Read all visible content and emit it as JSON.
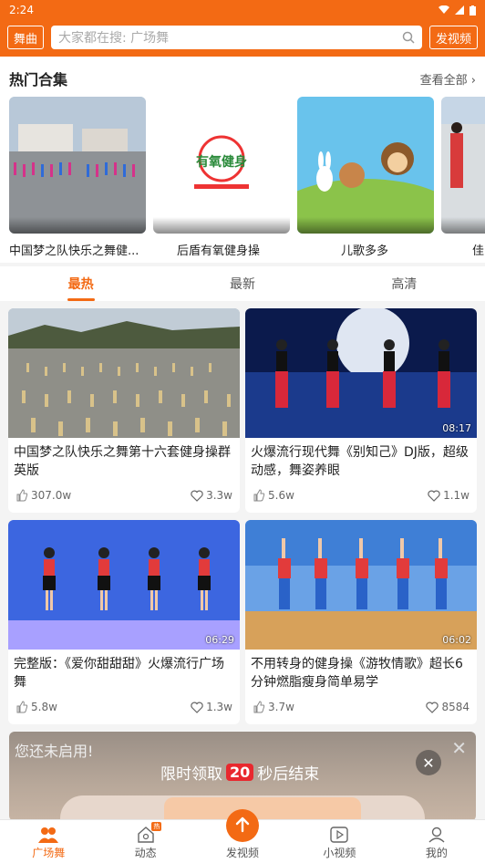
{
  "status_bar": {
    "time": "2:24"
  },
  "header": {
    "left_button": "舞曲",
    "search_placeholder": "大家都在搜: 广场舞",
    "right_button": "发视频"
  },
  "hot_section": {
    "title": "热门合集",
    "see_all": "查看全部",
    "items": [
      {
        "caption": "中国梦之队快乐之舞健..."
      },
      {
        "caption": "后盾有氧健身操",
        "logo_text": "有氧健身"
      },
      {
        "caption": "儿歌多多"
      },
      {
        "caption": "佳"
      }
    ]
  },
  "tabs": [
    "最热",
    "最新",
    "高清"
  ],
  "active_tab": 0,
  "videos": [
    {
      "title": "中国梦之队快乐之舞第十六套健身操群英版",
      "duration": "",
      "likes": "307.0w",
      "favorites": "3.3w"
    },
    {
      "title": "火爆流行现代舞《别知己》DJ版，超级动感，舞姿养眼",
      "duration": "08:17",
      "likes": "5.6w",
      "favorites": "1.1w"
    },
    {
      "title": "完整版：《爱你甜甜甜》火爆流行广场舞",
      "duration": "06:29",
      "likes": "5.8w",
      "favorites": "1.3w"
    },
    {
      "title": "不用转身的健身操《游牧情歌》超长6分钟燃脂瘦身简单易学",
      "duration": "06:02",
      "likes": "3.7w",
      "favorites": "8584"
    }
  ],
  "promo": {
    "note": "您还未启用!",
    "text_before": "限时领取",
    "countdown": "20",
    "text_after": "秒后结束"
  },
  "bottom_nav": [
    {
      "label": "广场舞",
      "icon": "people-icon"
    },
    {
      "label": "动态",
      "icon": "home-icon",
      "badge": "热"
    },
    {
      "label": "发视频",
      "icon": "upload-arrow-icon"
    },
    {
      "label": "小视频",
      "icon": "play-square-icon"
    },
    {
      "label": "我的",
      "icon": "person-icon"
    }
  ],
  "colors": {
    "accent": "#f36a14"
  }
}
